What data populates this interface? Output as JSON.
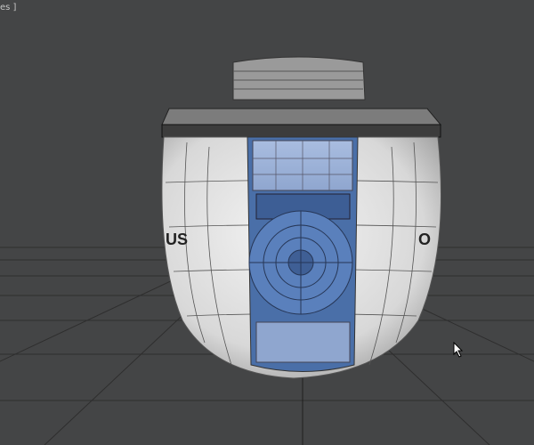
{
  "viewport": {
    "label": "es ]",
    "background": "#444546",
    "model": {
      "logo_text_left": "US",
      "logo_text_right": "O",
      "panel_color": "#5a7fb5",
      "shell_color": "#e6e6e6"
    }
  }
}
